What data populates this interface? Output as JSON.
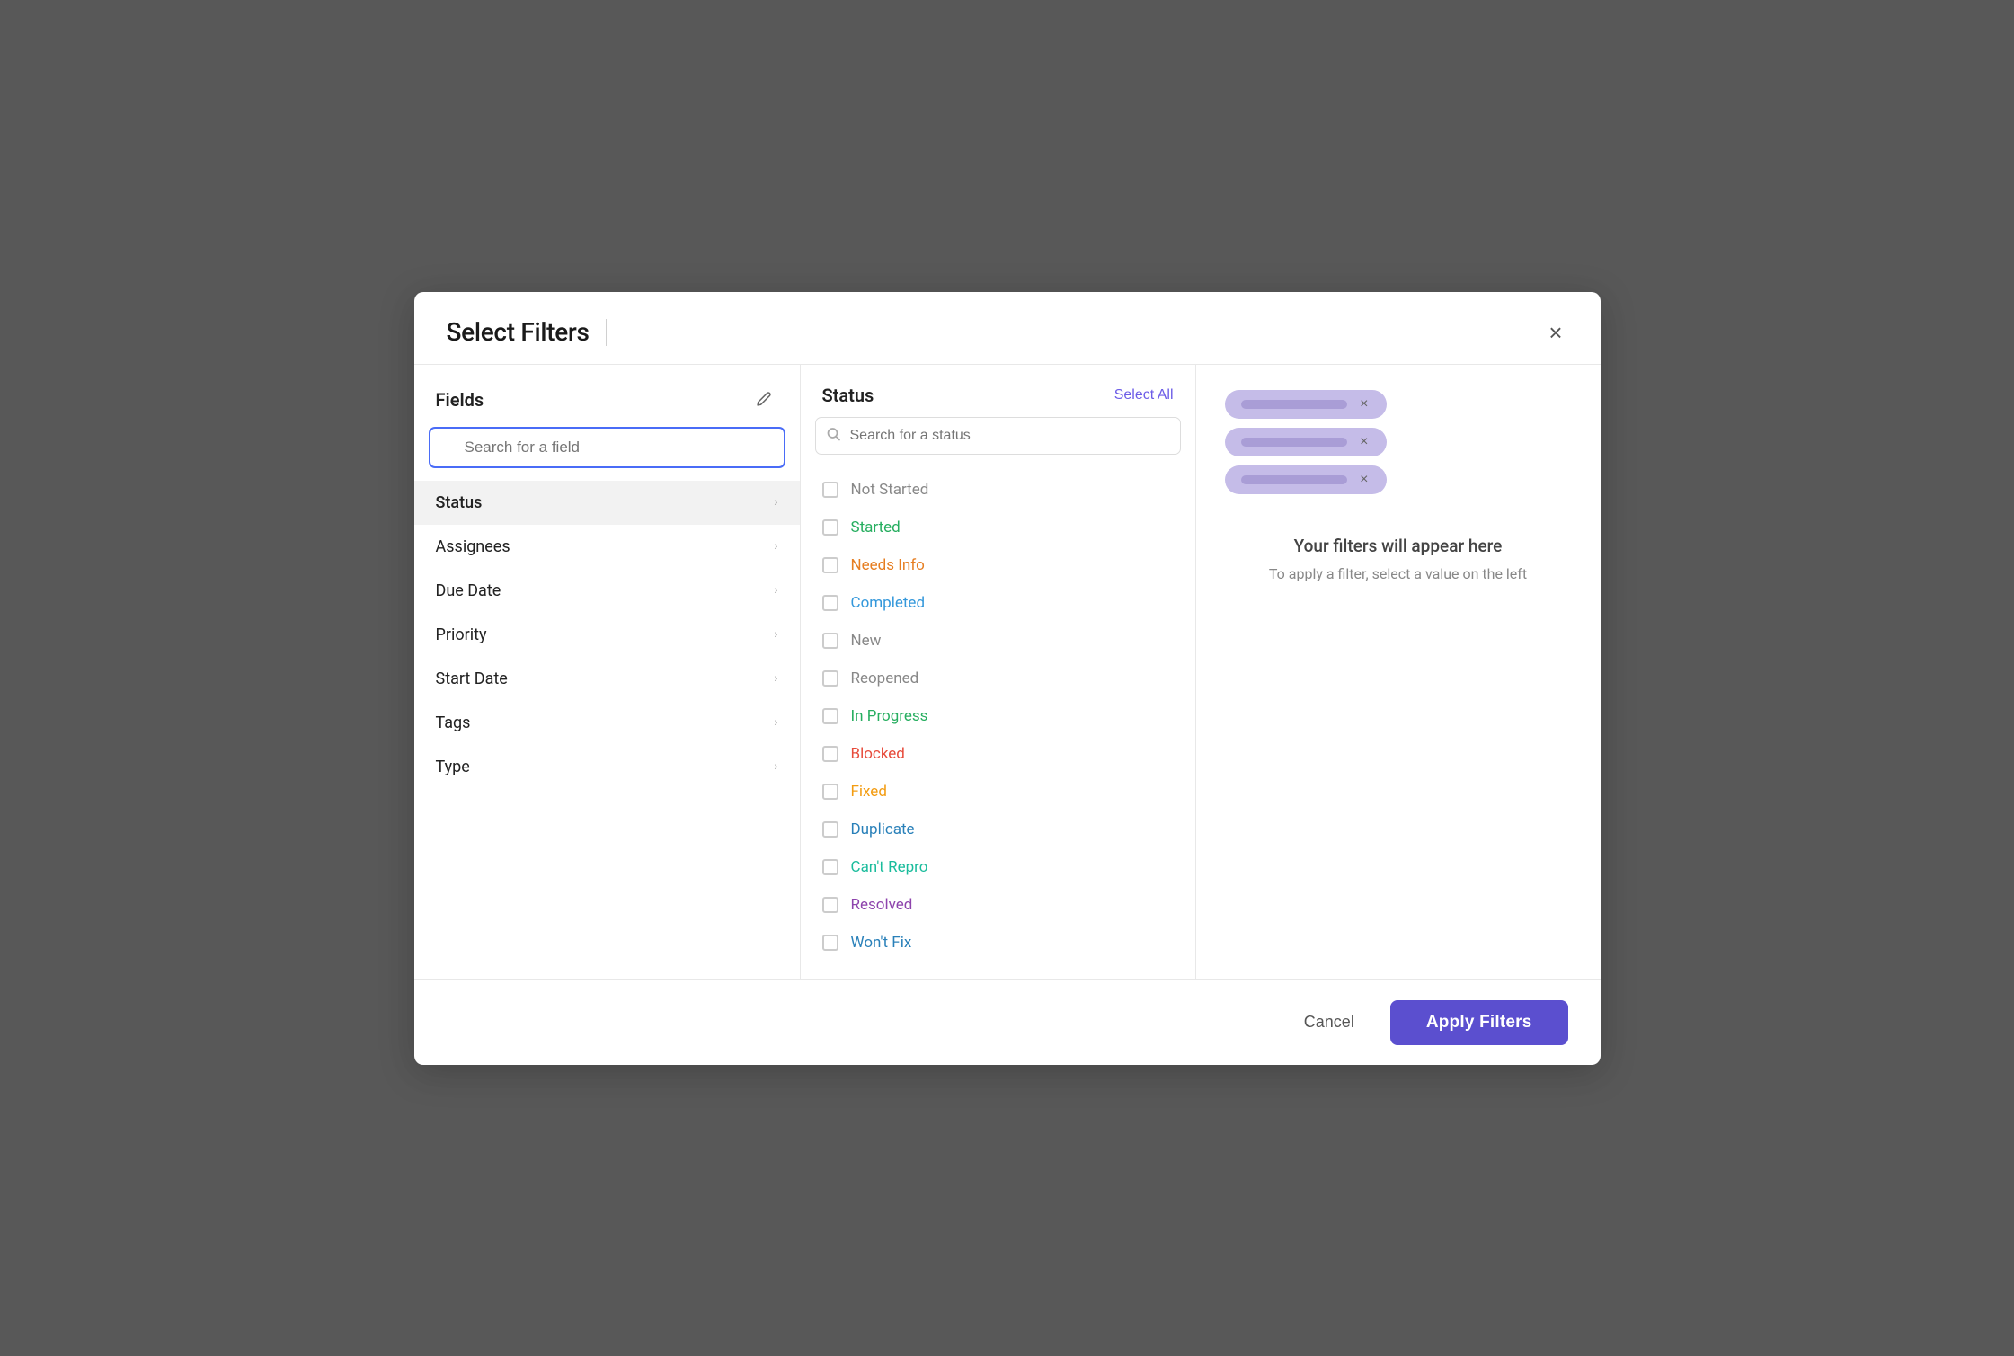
{
  "modal": {
    "title": "Select Filters",
    "close_label": "×"
  },
  "fields_panel": {
    "title": "Fields",
    "search_placeholder": "Search for a field",
    "edit_icon": "✏",
    "items": [
      {
        "label": "Status",
        "active": true
      },
      {
        "label": "Assignees",
        "active": false
      },
      {
        "label": "Due Date",
        "active": false
      },
      {
        "label": "Priority",
        "active": false
      },
      {
        "label": "Start Date",
        "active": false
      },
      {
        "label": "Tags",
        "active": false
      },
      {
        "label": "Type",
        "active": false
      }
    ]
  },
  "status_panel": {
    "title": "Status",
    "select_all_label": "Select All",
    "search_placeholder": "Search for a status",
    "items": [
      {
        "label": "Not Started",
        "color": "default",
        "checked": false
      },
      {
        "label": "Started",
        "color": "green",
        "checked": false
      },
      {
        "label": "Needs Info",
        "color": "orange",
        "checked": false
      },
      {
        "label": "Completed",
        "color": "blue-light",
        "checked": false
      },
      {
        "label": "New",
        "color": "gray",
        "checked": false
      },
      {
        "label": "Reopened",
        "color": "gray",
        "checked": false
      },
      {
        "label": "In Progress",
        "color": "green",
        "checked": false
      },
      {
        "label": "Blocked",
        "color": "red",
        "checked": false
      },
      {
        "label": "Fixed",
        "color": "orange2",
        "checked": false
      },
      {
        "label": "Duplicate",
        "color": "blue",
        "checked": false
      },
      {
        "label": "Can't Repro",
        "color": "teal",
        "checked": false
      },
      {
        "label": "Resolved",
        "color": "purple",
        "checked": false
      },
      {
        "label": "Won't Fix",
        "color": "blue",
        "checked": false
      }
    ]
  },
  "filters_panel": {
    "placeholder_title": "Your filters will appear here",
    "placeholder_sub": "To apply a filter, select a value on the left",
    "chips": [
      {
        "id": 1
      },
      {
        "id": 2
      },
      {
        "id": 3
      }
    ]
  },
  "footer": {
    "cancel_label": "Cancel",
    "apply_label": "Apply Filters"
  }
}
